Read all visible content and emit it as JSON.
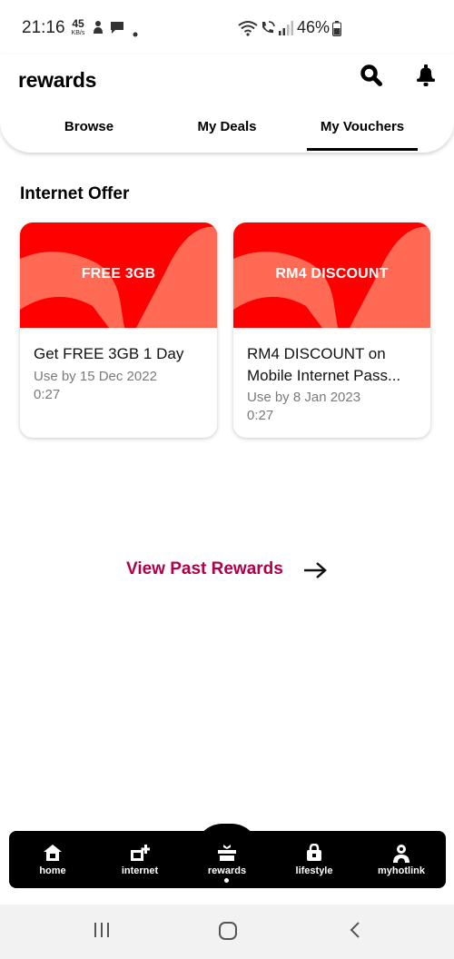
{
  "status_bar": {
    "time": "21:16",
    "speed_value": "45",
    "speed_unit": "KB/s",
    "battery": "46%"
  },
  "header": {
    "title": "rewards",
    "tabs": [
      {
        "label": "Browse"
      },
      {
        "label": "My Deals"
      },
      {
        "label": "My Vouchers",
        "active": true
      }
    ]
  },
  "section": {
    "title": "Internet Offer"
  },
  "vouchers": [
    {
      "banner": "FREE 3GB",
      "title": "Get FREE 3GB 1 Day",
      "use_by": "Use by 15 Dec 2022",
      "time": "0:27"
    },
    {
      "banner": "RM4 DISCOUNT",
      "title": "RM4 DISCOUNT on Mobile Internet Pass...",
      "use_by": "Use by 8 Jan 2023",
      "time": "0:27"
    }
  ],
  "view_past": {
    "label": "View Past Rewards"
  },
  "bottom_nav": [
    {
      "label": "home",
      "icon": "home-icon"
    },
    {
      "label": "internet",
      "icon": "internet-plus-icon"
    },
    {
      "label": "rewards",
      "icon": "rewards-icon",
      "active": true
    },
    {
      "label": "lifestyle",
      "icon": "lifestyle-bag-icon"
    },
    {
      "label": "myhotlink",
      "icon": "user-icon"
    }
  ],
  "colors": {
    "brand_red": "#ff0000",
    "banner_wave": "#ff6a55",
    "link_magenta": "#b0004a",
    "nav_bg": "#000000"
  }
}
